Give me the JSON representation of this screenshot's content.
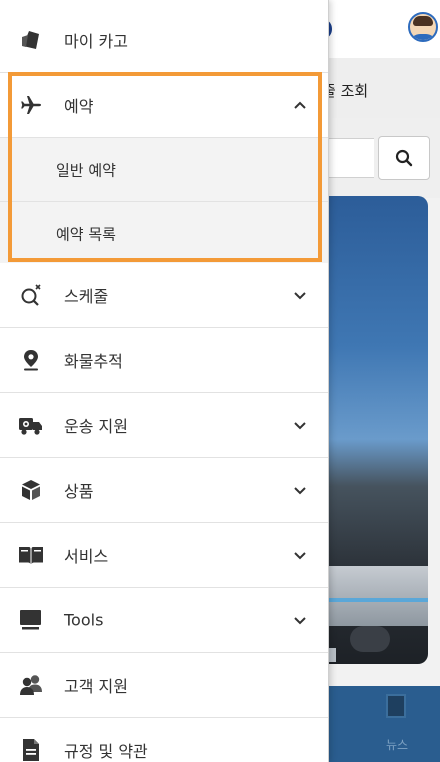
{
  "background": {
    "tab_label": "줄 조회",
    "bottom_nav_label": "뉴스"
  },
  "menu": {
    "items": [
      {
        "label": "마이 카고",
        "icon": "card-tag-icon",
        "chevron": null
      },
      {
        "label": "예약",
        "icon": "airplane-icon",
        "chevron": "up",
        "expanded": true,
        "subitems": [
          {
            "label": "일반 예약"
          },
          {
            "label": "예약 목록"
          }
        ]
      },
      {
        "label": "스케줄",
        "icon": "schedule-search-icon",
        "chevron": "down"
      },
      {
        "label": "화물추적",
        "icon": "location-pin-icon",
        "chevron": null
      },
      {
        "label": "운송 지원",
        "icon": "delivery-truck-icon",
        "chevron": "down"
      },
      {
        "label": "상품",
        "icon": "package-box-icon",
        "chevron": "down"
      },
      {
        "label": "서비스",
        "icon": "open-book-icon",
        "chevron": "down"
      },
      {
        "label": "Tools",
        "icon": "tools-monitor-icon",
        "chevron": "down"
      },
      {
        "label": "고객 지원",
        "icon": "people-icon",
        "chevron": null
      },
      {
        "label": "규정 및 약관",
        "icon": "document-icon",
        "chevron": null
      }
    ]
  },
  "colors": {
    "highlight": "#f39a37",
    "icon": "#333333",
    "sub_bg": "#f3f3f3"
  }
}
